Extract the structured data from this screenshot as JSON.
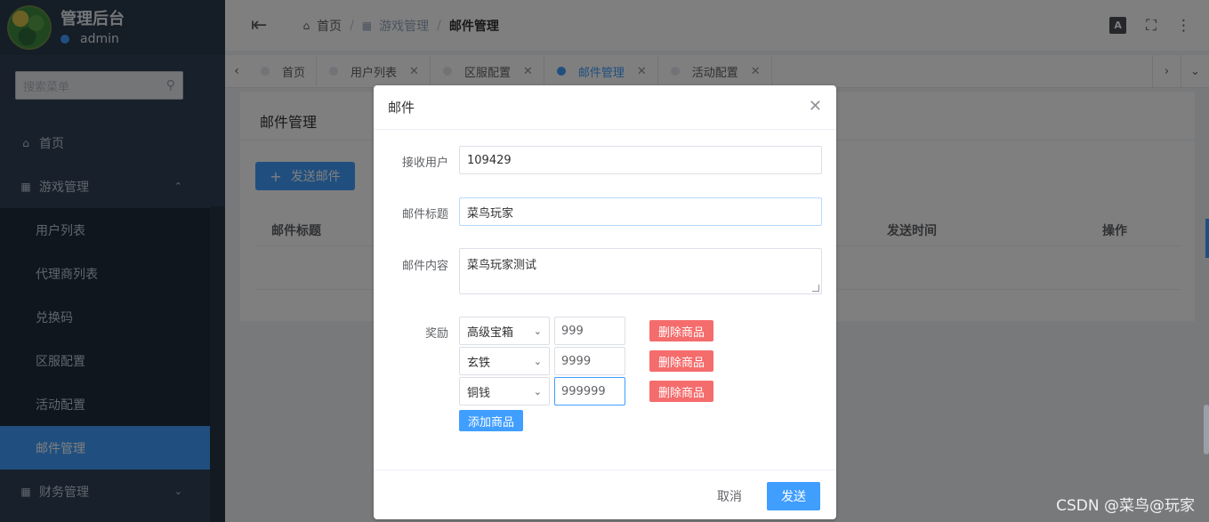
{
  "app": {
    "title": "管理后台",
    "user": "admin"
  },
  "sidebar": {
    "search_placeholder": "搜索菜单",
    "items": [
      {
        "label": "首页",
        "icon": "home-icon"
      },
      {
        "label": "游戏管理",
        "icon": "grid-icon",
        "expanded": true,
        "children": [
          {
            "label": "用户列表"
          },
          {
            "label": "代理商列表"
          },
          {
            "label": "兑换码"
          },
          {
            "label": "区服配置"
          },
          {
            "label": "活动配置"
          },
          {
            "label": "邮件管理",
            "active": true
          }
        ]
      },
      {
        "label": "财务管理",
        "icon": "grid-icon",
        "expanded": false
      }
    ]
  },
  "breadcrumb": [
    {
      "label": "首页",
      "icon": "home-icon"
    },
    {
      "label": "游戏管理",
      "icon": "grid-icon"
    },
    {
      "label": "邮件管理"
    }
  ],
  "topbar_icons": [
    "language-icon",
    "fullscreen-icon",
    "more-vertical-icon"
  ],
  "tabs": [
    {
      "label": "首页",
      "closable": false
    },
    {
      "label": "用户列表",
      "closable": true
    },
    {
      "label": "区服配置",
      "closable": true
    },
    {
      "label": "邮件管理",
      "closable": true,
      "active": true
    },
    {
      "label": "活动配置",
      "closable": true
    }
  ],
  "page": {
    "title": "邮件管理",
    "send_button": "发送邮件",
    "columns": {
      "mail_title": "邮件标题",
      "send_time": "发送时间",
      "actions": "操作"
    }
  },
  "dialog": {
    "title": "邮件",
    "recipient_label": "接收用户",
    "recipient_value": "109429",
    "subject_label": "邮件标题",
    "subject_value": "菜鸟玩家",
    "content_label": "邮件内容",
    "content_value": "菜鸟玩家测试",
    "reward_label": "奖励",
    "rewards": [
      {
        "item": "高级宝箱",
        "qty": "999",
        "delete_label": "删除商品"
      },
      {
        "item": "玄铁",
        "qty": "9999",
        "delete_label": "删除商品"
      },
      {
        "item": "铜钱",
        "qty": "999999",
        "delete_label": "删除商品"
      }
    ],
    "add_item_label": "添加商品",
    "cancel_label": "取消",
    "confirm_label": "发送"
  },
  "watermark": "CSDN @菜鸟@玩家",
  "colors": {
    "primary": "#409eff",
    "danger": "#f56c6c",
    "sidebar_bg": "#304156"
  }
}
